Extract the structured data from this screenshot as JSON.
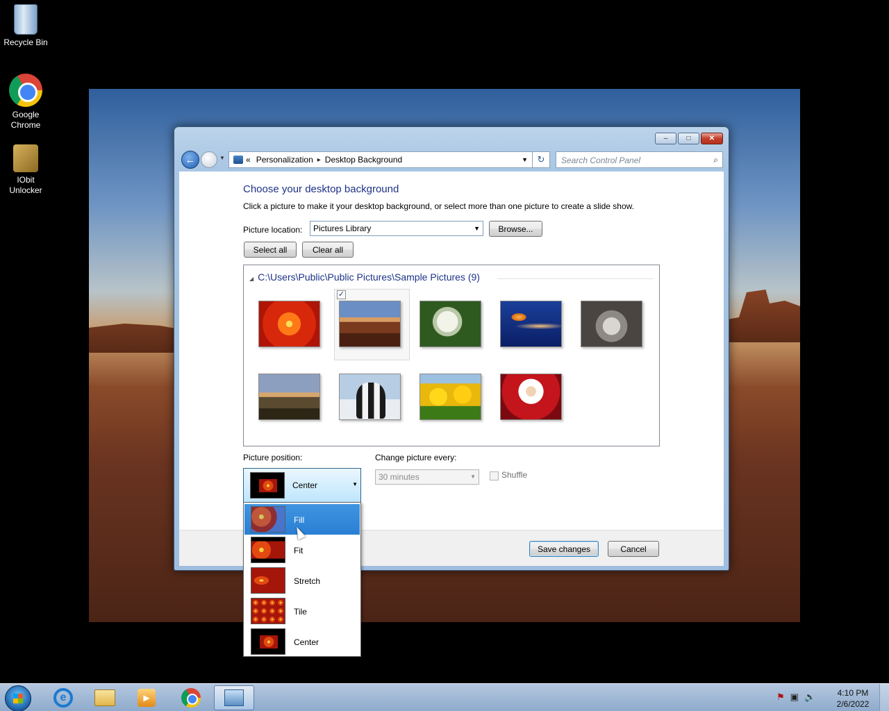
{
  "desktop": {
    "icons": [
      {
        "label": "Recycle Bin",
        "icon": "recycle-bin-icon"
      },
      {
        "label": "Google Chrome",
        "icon": "chrome-icon"
      },
      {
        "label": "IObit Unlocker",
        "icon": "unlocker-icon"
      }
    ]
  },
  "window": {
    "caption_buttons": {
      "minimize": "–",
      "maximize": "□",
      "close": "✕"
    },
    "nav": {
      "back_glyph": "←",
      "breadcrumb": [
        "Personalization",
        "Desktop Background"
      ],
      "breadcrumb_prefix": "«",
      "crumb_sep": "▸",
      "search_placeholder": "Search Control Panel",
      "search_glyph": "⌕",
      "refresh_glyph": "↻"
    },
    "title": "Choose your desktop background",
    "description": "Click a picture to make it your desktop background, or select more than one picture to create a slide show.",
    "picture_location": {
      "label": "Picture location:",
      "value": "Pictures Library"
    },
    "buttons": {
      "browse": "Browse...",
      "select_all": "Select all",
      "clear_all": "Clear all",
      "save": "Save changes",
      "cancel": "Cancel"
    },
    "group": {
      "header": "C:\\Users\\Public\\Public Pictures\\Sample Pictures (9)",
      "pictures": [
        "Chrysanthemum",
        "Desert",
        "Hydrangeas",
        "Jellyfish",
        "Koala",
        "Lighthouse",
        "Penguins",
        "Tulips",
        "Santa"
      ],
      "selected_index": 1,
      "check_glyph": "✓"
    },
    "picture_position": {
      "label": "Picture position:",
      "value": "Center"
    },
    "change_picture": {
      "label": "Change picture every:",
      "value": "30 minutes",
      "disabled": true
    },
    "shuffle": {
      "label": "Shuffle",
      "checked": false
    }
  },
  "dropdown": {
    "options": [
      "Fill",
      "Fit",
      "Stretch",
      "Tile",
      "Center"
    ],
    "highlighted": "Fill"
  },
  "taskbar": {
    "apps": [
      "Internet Explorer",
      "Windows Explorer",
      "Windows Media Player",
      "Google Chrome",
      "Control Panel"
    ],
    "active_app": "Control Panel",
    "ie_glyph": "e",
    "media_glyph": "▶",
    "tray_glyphs": [
      "⚑",
      "▣",
      "🔈"
    ],
    "time": "4:10 PM",
    "date": "2/6/2022"
  },
  "colors": {
    "title_blue": "#1e3287",
    "selection_blue": "#2a7fd4"
  }
}
